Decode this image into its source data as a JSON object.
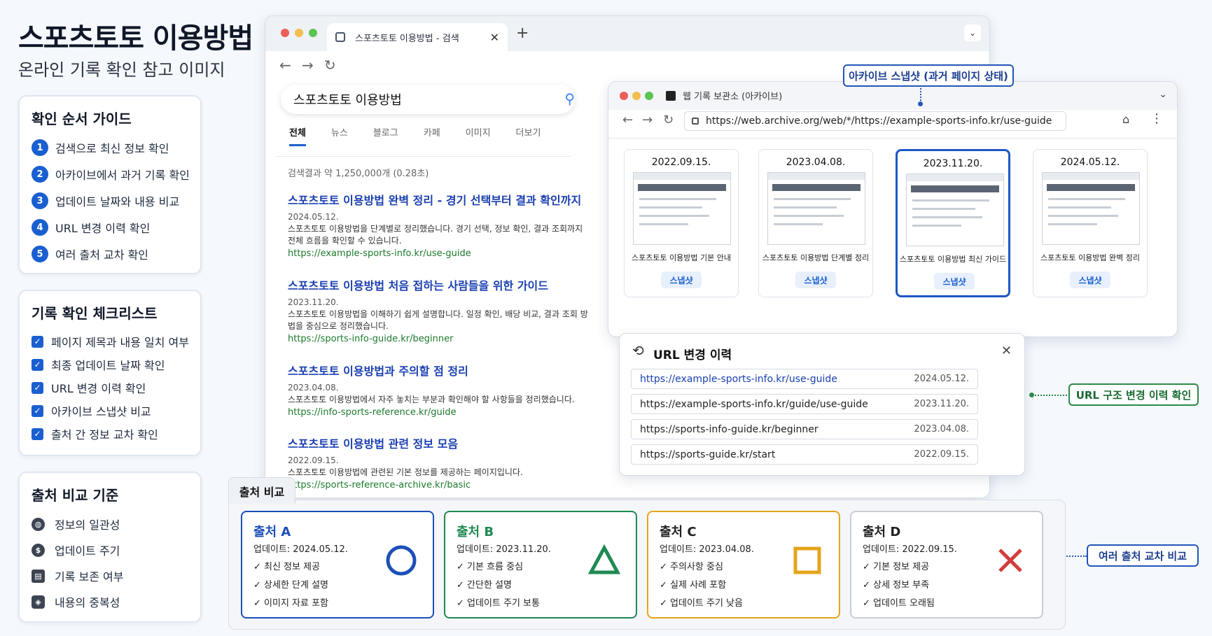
{
  "page": {
    "title": "스포츠토토 이용방법",
    "subtitle": "온라인 기록 확인 참고 이미지"
  },
  "guide": {
    "title": "확인 순서 가이드",
    "steps": [
      {
        "num": "1",
        "label": "검색으로 최신 정보 확인"
      },
      {
        "num": "2",
        "label": "아카이브에서 과거 기록 확인"
      },
      {
        "num": "3",
        "label": "업데이트 날짜와 내용 비교"
      },
      {
        "num": "4",
        "label": "URL 변경 이력 확인"
      },
      {
        "num": "5",
        "label": "여러 출처 교차 확인"
      }
    ]
  },
  "checklist": {
    "title": "기록 확인 체크리스트",
    "items": [
      "페이지 제목과 내용 일치 여부",
      "최종 업데이트 날짜 확인",
      "URL 변경 이력 확인",
      "아카이브 스냅샷 비교",
      "출처 간 정보 교차 확인"
    ]
  },
  "criteria": {
    "title": "출처 비교 기준",
    "items": [
      {
        "label": "정보의 일관성",
        "icon": "globe-icon"
      },
      {
        "label": "업데이트 주기",
        "icon": "dollar-icon"
      },
      {
        "label": "기록 보존 여부",
        "icon": "archive-icon"
      },
      {
        "label": "내용의 중복성",
        "icon": "cube-icon"
      }
    ]
  },
  "search_window": {
    "tab_title": "스포츠토토 이용방법 - 검색",
    "query": "스포츠토토 이용방법",
    "tabs": [
      "전체",
      "뉴스",
      "블로그",
      "카페",
      "이미지",
      "더보기"
    ],
    "result_count": "검색결과 약 1,250,000개 (0.28초)",
    "results": [
      {
        "title": "스포츠토토 이용방법 완벽 정리 - 경기 선택부터 결과 확인까지",
        "date": "2024.05.12.",
        "desc": "스포츠토토 이용방법을 단계별로 정리했습니다. 경기 선택, 정보 확인, 결과 조회까지 전체 흐름을 확인할 수 있습니다.",
        "url": "https://example-sports-info.kr/use-guide"
      },
      {
        "title": "스포츠토토 이용방법 처음 접하는 사람들을 위한 가이드",
        "date": "2023.11.20.",
        "desc": "스포츠토토 이용방법을 이해하기 쉽게 설명합니다. 일정 확인, 배당 비교, 결과 조회 방법을 중심으로 정리했습니다.",
        "url": "https://sports-info-guide.kr/beginner"
      },
      {
        "title": "스포츠토토 이용방법과 주의할 점 정리",
        "date": "2023.04.08.",
        "desc": "스포츠토토 이용방법에서 자주 놓치는 부분과 확인해야 할 사항들을 정리했습니다.",
        "url": "https://info-sports-reference.kr/guide"
      },
      {
        "title": "스포츠토토 이용방법 관련 정보 모음",
        "date": "2022.09.15.",
        "desc": "스포츠토토 이용방법에 관련된 기본 정보를 제공하는 페이지입니다.",
        "url": "https://sports-reference-archive.kr/basic"
      }
    ]
  },
  "archive_window": {
    "title": "웹 기록 보관소 (아카이브)",
    "url": "https://web.archive.org/web/*/https://example-sports-info.kr/use-guide",
    "snapshots": [
      {
        "date": "2022.09.15.",
        "label": "스포츠토토 이용방법 기본 안내",
        "button": "스냅샷"
      },
      {
        "date": "2023.04.08.",
        "label": "스포츠토토 이용방법 단계별 정리",
        "button": "스냅샷"
      },
      {
        "date": "2023.11.20.",
        "label": "스포츠토토 이용방법 최신 가이드",
        "button": "스냅샷"
      },
      {
        "date": "2024.05.12.",
        "label": "스포츠토토 이용방법 완벽 정리",
        "button": "스냅샷"
      }
    ]
  },
  "url_history": {
    "title": "URL 변경 이력",
    "rows": [
      {
        "url": "https://example-sports-info.kr/use-guide",
        "date": "2024.05.12."
      },
      {
        "url": "https://example-sports-info.kr/guide/use-guide",
        "date": "2023.11.20."
      },
      {
        "url": "https://sports-info-guide.kr/beginner",
        "date": "2023.04.08."
      },
      {
        "url": "https://sports-guide.kr/start",
        "date": "2022.09.15."
      }
    ]
  },
  "callouts": {
    "archive": "아카이브 스냅샷 (과거 페이지 상태)",
    "url_change": "URL 구조 변경 이력 확인",
    "cross_check": "여러 출처 교차 비교"
  },
  "comparison": {
    "tab_label": "출처 비교",
    "sources": [
      {
        "name": "출처 A",
        "date": "업데이트: 2024.05.12.",
        "items": [
          "최신 정보 제공",
          "상세한 단계 설명",
          "이미지 자료 포함"
        ],
        "color": "#1d4fb8",
        "shape": "circle"
      },
      {
        "name": "출처 B",
        "date": "업데이트: 2023.11.20.",
        "items": [
          "기본 흐름 중심",
          "간단한 설명",
          "업데이트 주기 보통"
        ],
        "color": "#1e8a52",
        "shape": "triangle"
      },
      {
        "name": "출처 C",
        "date": "업데이트: 2023.04.08.",
        "items": [
          "주의사항 중심",
          "실제 사례 포함",
          "업데이트 주기 낮음"
        ],
        "color": "#e3a51c",
        "shape": "square"
      },
      {
        "name": "출처 D",
        "date": "업데이트: 2022.09.15.",
        "items": [
          "기본 정보 제공",
          "상세 정보 부족",
          "업데이트 오래됨"
        ],
        "color": "#d23c3c",
        "shape": "x"
      }
    ]
  }
}
